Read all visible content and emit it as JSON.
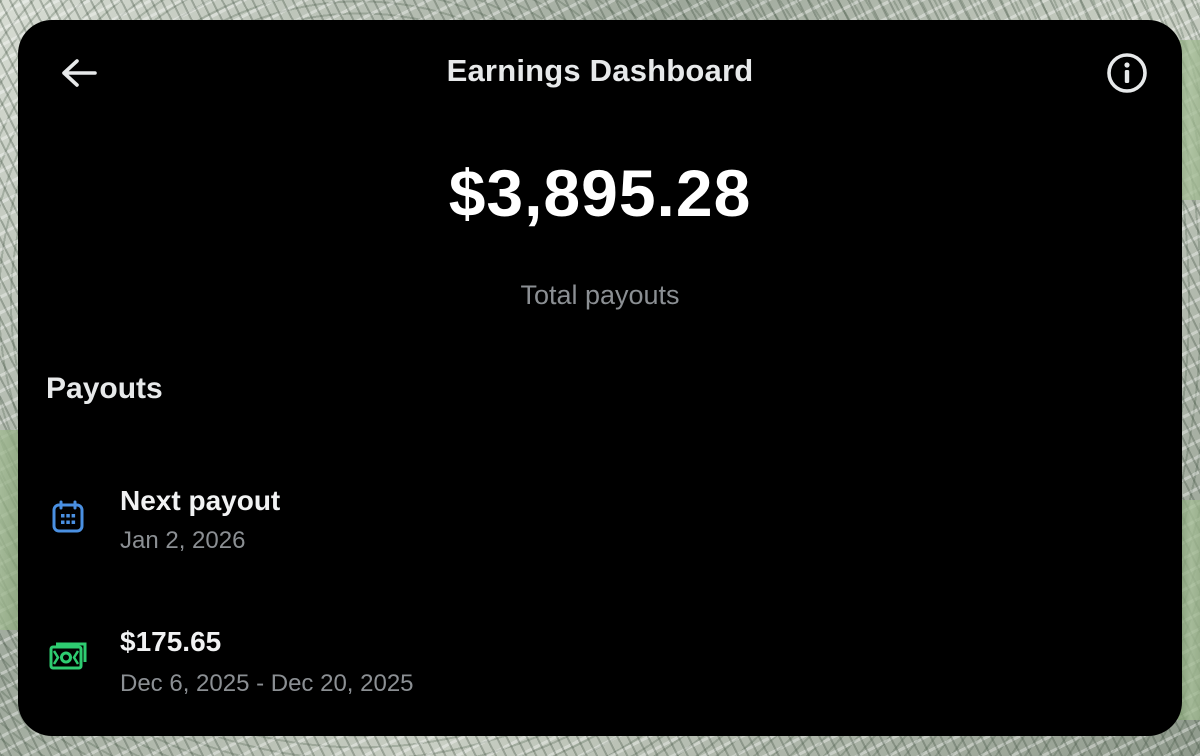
{
  "header": {
    "title": "Earnings Dashboard",
    "back_icon": "arrow-left-icon",
    "info_icon": "info-circle-icon"
  },
  "summary": {
    "total_amount": "$3,895.28",
    "total_label": "Total payouts"
  },
  "payouts": {
    "section_title": "Payouts",
    "items": [
      {
        "icon": "calendar-icon",
        "icon_color": "#4a90e2",
        "title": "Next payout",
        "subtitle": "Jan 2, 2026"
      },
      {
        "icon": "cash-icon",
        "icon_color": "#2ecc71",
        "title": "$175.65",
        "subtitle": "Dec 6, 2025 - Dec 20, 2025"
      }
    ]
  },
  "colors": {
    "card_background": "#000000",
    "primary_text": "#e7e9ea",
    "secondary_text": "#8b8f93"
  }
}
